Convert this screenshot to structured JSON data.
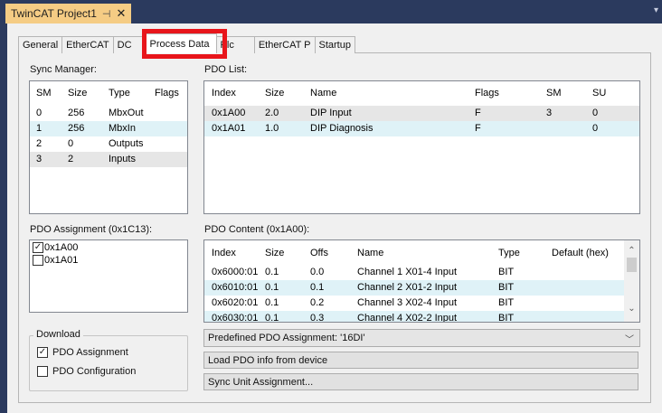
{
  "window": {
    "doc_tab_title": "TwinCAT Project1",
    "pin_glyph": "⊣",
    "close_glyph": "✕"
  },
  "tabs": [
    "General",
    "EtherCAT",
    "DC",
    "Process Data",
    "Plc",
    "EtherCAT P",
    "Startup"
  ],
  "active_tab": "Process Data",
  "sync_manager": {
    "label": "Sync Manager:",
    "columns": [
      "SM",
      "Size",
      "Type",
      "Flags"
    ],
    "rows": [
      [
        "0",
        "256",
        "MbxOut",
        ""
      ],
      [
        "1",
        "256",
        "MbxIn",
        ""
      ],
      [
        "2",
        "0",
        "Outputs",
        ""
      ],
      [
        "3",
        "2",
        "Inputs",
        ""
      ]
    ]
  },
  "pdo_list": {
    "label": "PDO List:",
    "columns": [
      "Index",
      "Size",
      "Name",
      "Flags",
      "SM",
      "SU"
    ],
    "rows": [
      [
        "0x1A00",
        "2.0",
        "DIP Input",
        "F",
        "3",
        "0"
      ],
      [
        "0x1A01",
        "1.0",
        "DIP Diagnosis",
        "F",
        "",
        "0"
      ]
    ]
  },
  "pdo_assignment": {
    "label": "PDO Assignment (0x1C13):",
    "items": [
      {
        "label": "0x1A00",
        "checked": true
      },
      {
        "label": "0x1A01",
        "checked": false
      }
    ]
  },
  "pdo_content": {
    "label": "PDO Content (0x1A00):",
    "columns": [
      "Index",
      "Size",
      "Offs",
      "Name",
      "Type",
      "Default (hex)"
    ],
    "rows": [
      [
        "0x6000:01",
        "0.1",
        "0.0",
        "Channel 1 X01-4 Input",
        "BIT",
        ""
      ],
      [
        "0x6010:01",
        "0.1",
        "0.1",
        "Channel 2 X01-2 Input",
        "BIT",
        ""
      ],
      [
        "0x6020:01",
        "0.1",
        "0.2",
        "Channel 3 X02-4 Input",
        "BIT",
        ""
      ],
      [
        "0x6030:01",
        "0.1",
        "0.3",
        "Channel 4 X02-2 Input",
        "BIT",
        ""
      ]
    ]
  },
  "download": {
    "title": "Download",
    "pdo_assignment": {
      "label": "PDO Assignment",
      "checked": true
    },
    "pdo_configuration": {
      "label": "PDO Configuration",
      "checked": false
    }
  },
  "predefined_combo": "Predefined PDO Assignment: '16DI'",
  "load_button": "Load PDO info from device",
  "sync_unit_button": "Sync Unit Assignment...",
  "colors": {
    "frame": "#2b3a5e",
    "doc_tab": "#f5cc84",
    "highlight_box": "#e8151b",
    "row_alt": "#dff2f7"
  }
}
